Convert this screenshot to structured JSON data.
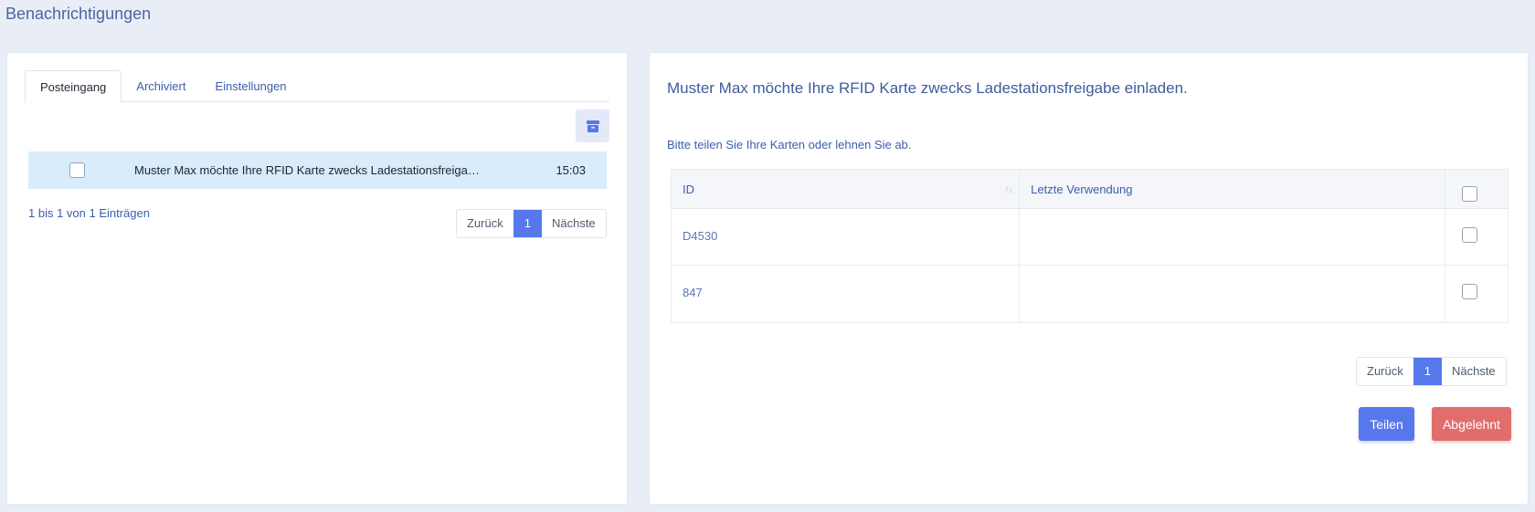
{
  "page": {
    "title": "Benachrichtigungen"
  },
  "inbox": {
    "tabs": [
      "Posteingang",
      "Archiviert",
      "Einstellungen"
    ],
    "active_tab": "Posteingang",
    "archive_icon": "archive-box-icon",
    "messages": [
      {
        "text": "Muster Max möchte Ihre RFID Karte zwecks Ladestationsfreiga…",
        "time": "15:03",
        "checked": false
      }
    ],
    "entries_info": "1 bis 1 von 1 Einträgen",
    "pagination": {
      "prev": "Zurück",
      "page": "1",
      "next": "Nächste"
    }
  },
  "detail": {
    "heading": "Muster Max möchte Ihre RFID Karte zwecks Ladestationsfreigabe einladen.",
    "subtext": "Bitte teilen Sie Ihre Karten oder lehnen Sie ab.",
    "table": {
      "col_id": "ID",
      "col_last_use": "Letzte Verwendung",
      "rows": [
        {
          "id": "D4530",
          "last_use": ""
        },
        {
          "id": "847",
          "last_use": ""
        }
      ]
    },
    "pagination": {
      "prev": "Zurück",
      "page": "1",
      "next": "Nächste"
    },
    "share_button": "Teilen",
    "reject_button": "Abgelehnt"
  },
  "colors": {
    "accent": "#5678ec",
    "danger": "#e26d6d",
    "selected_row": "#d9ecfb",
    "background": "#e9eef6"
  }
}
